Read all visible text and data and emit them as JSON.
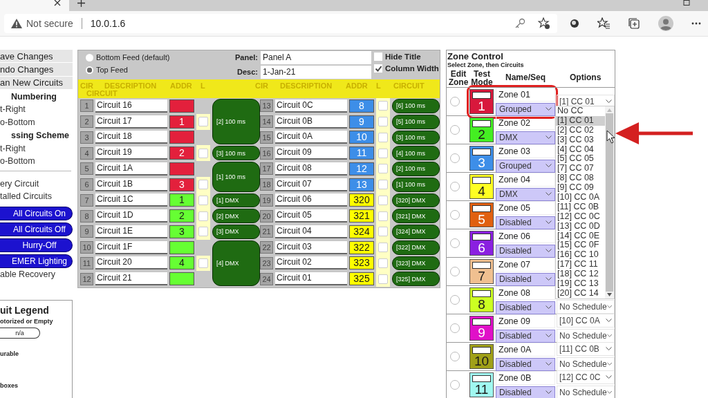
{
  "browser": {
    "security": "Not secure",
    "url": "10.0.1.6"
  },
  "sidebar": {
    "file_buttons": [
      "ave Changes",
      "ndo Changes",
      "an New Circuits"
    ],
    "sections": [
      {
        "heading": "Numbering",
        "options": [
          "t-Right",
          "o-Bottom"
        ]
      },
      {
        "heading": "ssing Scheme",
        "options": [
          "t-Right",
          "o-Bottom"
        ]
      }
    ],
    "links": [
      "ery Circuit",
      "talled Circuits"
    ],
    "actions": [
      "All Circuits On",
      "All Circuits Off",
      "Hurry-Off",
      "EMER Lighting"
    ],
    "recovery": "able Recovery",
    "legend": {
      "title": "uit Legend",
      "items": [
        {
          "kind": "heading",
          "text": "otorized or Empty"
        },
        {
          "kind": "pill",
          "text": "n/a"
        },
        {
          "kind": "heading",
          "text": "urable"
        },
        {
          "kind": "gap_heading",
          "text": "boxes"
        }
      ]
    }
  },
  "panel": {
    "feeds": [
      {
        "label": "Bottom Feed (default)",
        "selected": false
      },
      {
        "label": "Top Feed",
        "selected": true
      }
    ],
    "fields": [
      {
        "label": "Panel:",
        "value": "Panel A"
      },
      {
        "label": "Desc:",
        "value": "1-Jan-21"
      }
    ],
    "checks": [
      {
        "label": "Hide Title",
        "checked": false
      },
      {
        "label": "Column Width",
        "checked": true
      }
    ],
    "banks": [
      {
        "headers": [
          "CIR",
          "DESCRIPTION",
          "ADDR",
          "L",
          "CIRCUIT"
        ],
        "groups": [
          {
            "circuit": "[2] 100 ms",
            "rows": [
              {
                "cir": "1",
                "desc": "Circuit 16",
                "color": "#e3203c"
              },
              {
                "cir": "2",
                "desc": "Circuit 17",
                "addr": "1",
                "color": "#e3203c",
                "l_checked": false
              },
              {
                "cir": "3",
                "desc": "Circuit 18",
                "color": "#e3203c"
              }
            ]
          },
          {
            "circuit": "[3] 100 ms",
            "rows": [
              {
                "cir": "4",
                "desc": "Circuit 19",
                "addr": "2",
                "color": "#e3203c",
                "l_checked": false
              }
            ]
          },
          {
            "circuit": "[1] 100 ms",
            "rows": [
              {
                "cir": "5",
                "desc": "Circuit 1A",
                "color": "#e3203c"
              },
              {
                "cir": "6",
                "desc": "Circuit 1B",
                "addr": "3",
                "color": "#e3203c",
                "l_checked": false
              }
            ]
          },
          {
            "circuit": "[1] DMX",
            "rows": [
              {
                "cir": "7",
                "desc": "Circuit 1C",
                "addr": "1",
                "color": "#66ff33",
                "l_checked": false
              }
            ]
          },
          {
            "circuit": "[2] DMX",
            "rows": [
              {
                "cir": "8",
                "desc": "Circuit 1D",
                "addr": "2",
                "color": "#66ff33",
                "l_checked": false
              }
            ]
          },
          {
            "circuit": "[3] DMX",
            "rows": [
              {
                "cir": "9",
                "desc": "Circuit 1E",
                "addr": "3",
                "color": "#66ff33",
                "l_checked": false
              }
            ]
          },
          {
            "circuit": "[4] DMX",
            "rows": [
              {
                "cir": "10",
                "desc": "Circuit 1F",
                "color": "#66ff33"
              },
              {
                "cir": "11",
                "desc": "Circuit 20",
                "addr": "4",
                "color": "#66ff33",
                "l_checked": false
              },
              {
                "cir": "12",
                "desc": "Circuit 21",
                "color": "#66ff33"
              }
            ]
          }
        ]
      },
      {
        "headers": [
          "CIR",
          "DESCRIPTION",
          "ADDR",
          "L",
          "CIRCUIT"
        ],
        "groups": [
          {
            "circuit": "[6] 100 ms",
            "rows": [
              {
                "cir": "13",
                "desc": "Circuit 0C",
                "addr": "8",
                "color": "#3d8ee8",
                "l_checked": false
              }
            ]
          },
          {
            "circuit": "[5] 100 ms",
            "rows": [
              {
                "cir": "14",
                "desc": "Circuit 0B",
                "addr": "9",
                "color": "#3d8ee8",
                "l_checked": false
              }
            ]
          },
          {
            "circuit": "[3] 100 ms",
            "rows": [
              {
                "cir": "15",
                "desc": "Circuit 0A",
                "addr": "10",
                "color": "#3d8ee8",
                "l_checked": false
              }
            ]
          },
          {
            "circuit": "[4] 100 ms",
            "rows": [
              {
                "cir": "16",
                "desc": "Circuit 09",
                "addr": "11",
                "color": "#3d8ee8",
                "l_checked": false
              }
            ]
          },
          {
            "circuit": "[2] 100 ms",
            "rows": [
              {
                "cir": "17",
                "desc": "Circuit 08",
                "addr": "12",
                "color": "#3d8ee8",
                "l_checked": false
              }
            ]
          },
          {
            "circuit": "[1] 100 ms",
            "rows": [
              {
                "cir": "18",
                "desc": "Circuit 07",
                "addr": "13",
                "color": "#3d8ee8",
                "l_checked": false
              }
            ]
          },
          {
            "circuit": "[320] DMX",
            "rows": [
              {
                "cir": "19",
                "desc": "Circuit 06",
                "addr": "320",
                "color": "#ffff00",
                "l_checked": false
              }
            ]
          },
          {
            "circuit": "[321] DMX",
            "rows": [
              {
                "cir": "20",
                "desc": "Circuit 05",
                "addr": "321",
                "color": "#ffff00",
                "l_checked": false
              }
            ]
          },
          {
            "circuit": "[324] DMX",
            "rows": [
              {
                "cir": "21",
                "desc": "Circuit 04",
                "addr": "324",
                "color": "#ffff00",
                "l_checked": false
              }
            ]
          },
          {
            "circuit": "[322] DMX",
            "rows": [
              {
                "cir": "22",
                "desc": "Circuit 03",
                "addr": "322",
                "color": "#ffff00",
                "l_checked": false
              }
            ]
          },
          {
            "circuit": "[323] DMX",
            "rows": [
              {
                "cir": "23",
                "desc": "Circuit 02",
                "addr": "323",
                "color": "#ffff00",
                "l_checked": false
              }
            ]
          },
          {
            "circuit": "[325] DMX",
            "rows": [
              {
                "cir": "24",
                "desc": "Circuit 01",
                "addr": "325",
                "color": "#ffff00",
                "l_checked": false
              }
            ]
          }
        ]
      }
    ]
  },
  "zone_control": {
    "title": "Zone Control",
    "subtitle": "Select Zone, then Circuits",
    "columns": [
      "Edit Zone",
      "Test Mode",
      "Name/Seq",
      "Options"
    ],
    "zones": [
      {
        "number": "1",
        "name": "Zone 01",
        "mode": "Grouped",
        "color": "#d8183c",
        "selected": false,
        "highlighted": true,
        "cc": "[1] CC 01"
      },
      {
        "number": "2",
        "name": "Zone 02",
        "mode": "DMX",
        "color": "#44ee22",
        "selected": false,
        "highlighted": false
      },
      {
        "number": "3",
        "name": "Zone 03",
        "mode": "Grouped",
        "color": "#3d8ee8",
        "selected": false,
        "highlighted": false
      },
      {
        "number": "4",
        "name": "Zone 04",
        "mode": "DMX",
        "color": "#ffff22",
        "selected": false,
        "highlighted": false
      },
      {
        "number": "5",
        "name": "Zone 05",
        "mode": "Disabled",
        "color": "#e06010",
        "selected": false,
        "highlighted": false
      },
      {
        "number": "6",
        "name": "Zone 06",
        "mode": "Disabled",
        "color": "#8a20e0",
        "selected": false,
        "highlighted": false
      },
      {
        "number": "7",
        "name": "Zone 07",
        "mode": "Disabled",
        "color": "#f0c090",
        "selected": false,
        "highlighted": false
      },
      {
        "number": "8",
        "name": "Zone 08",
        "mode": "Disabled",
        "color": "#ccff22",
        "selected": false,
        "highlighted": false,
        "schedule": "No Schedule"
      },
      {
        "number": "9",
        "name": "Zone 09",
        "mode": "Disabled",
        "color": "#e010c8",
        "selected": false,
        "highlighted": false,
        "cc": "[10] CC 0A",
        "schedule": "No Schedule"
      },
      {
        "number": "10",
        "name": "Zone 0A",
        "mode": "Disabled",
        "color": "#a0a018",
        "selected": false,
        "highlighted": false,
        "cc": "[11] CC 0B",
        "schedule": "No Schedule"
      },
      {
        "number": "11",
        "name": "Zone 0B",
        "mode": "Disabled",
        "color": "#a0f8f0",
        "selected": false,
        "highlighted": false,
        "cc": "[12] CC 0C",
        "schedule": "No Schedule"
      }
    ],
    "dropdown": [
      {
        "label": "No CC",
        "selected": false
      },
      {
        "label": "[1] CC 01",
        "selected": true
      },
      {
        "label": "[2] CC 02",
        "selected": false
      },
      {
        "label": "[3] CC 03",
        "selected": false
      },
      {
        "label": "[4] CC 04",
        "selected": false
      },
      {
        "label": "[5] CC 05",
        "selected": false
      },
      {
        "label": "[7] CC 07",
        "selected": false
      },
      {
        "label": "[8] CC 08",
        "selected": false
      },
      {
        "label": "[9] CC 09",
        "selected": false
      },
      {
        "label": "[10] CC 0A",
        "selected": false
      },
      {
        "label": "[11] CC 0B",
        "selected": false
      },
      {
        "label": "[12] CC 0C",
        "selected": false
      },
      {
        "label": "[13] CC 0D",
        "selected": false
      },
      {
        "label": "[14] CC 0E",
        "selected": false
      },
      {
        "label": "[15] CC 0F",
        "selected": false
      },
      {
        "label": "[16] CC 10",
        "selected": false
      },
      {
        "label": "[17] CC 11",
        "selected": false
      },
      {
        "label": "[18] CC 12",
        "selected": false
      },
      {
        "label": "[19] CC 13",
        "selected": false
      },
      {
        "label": "[20] CC 14",
        "selected": false
      }
    ]
  }
}
